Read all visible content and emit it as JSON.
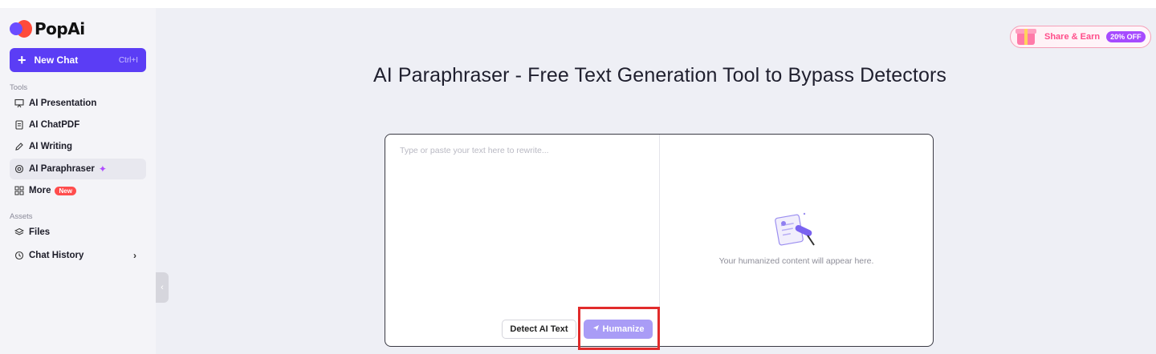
{
  "app": {
    "logo_text": "PopAi"
  },
  "sidebar": {
    "new_chat": {
      "label": "New Chat",
      "shortcut": "Ctrl+I"
    },
    "tools_label": "Tools",
    "tools": [
      {
        "label": "AI Presentation",
        "icon": "presentation-icon"
      },
      {
        "label": "AI ChatPDF",
        "icon": "document-icon"
      },
      {
        "label": "AI Writing",
        "icon": "pen-icon"
      },
      {
        "label": "AI Paraphraser",
        "icon": "paraphrase-icon",
        "active": true
      },
      {
        "label": "More",
        "icon": "grid-icon",
        "badge": "New"
      }
    ],
    "assets_label": "Assets",
    "assets": [
      {
        "label": "Files",
        "icon": "layers-icon"
      },
      {
        "label": "Chat History",
        "icon": "history-icon"
      }
    ]
  },
  "promo": {
    "label": "Share & Earn",
    "badge": "20% OFF"
  },
  "page": {
    "title": "AI Paraphraser - Free Text Generation Tool to Bypass Detectors"
  },
  "editor": {
    "input_placeholder": "Type or paste your text here to rewrite...",
    "input_value": "",
    "detect_label": "Detect AI Text",
    "humanize_label": "Humanize",
    "empty_output": "Your humanized content will appear here."
  },
  "colors": {
    "accent": "#5b3df5",
    "humanize_disabled": "#a99cf6",
    "highlight": "#e12b2b"
  }
}
